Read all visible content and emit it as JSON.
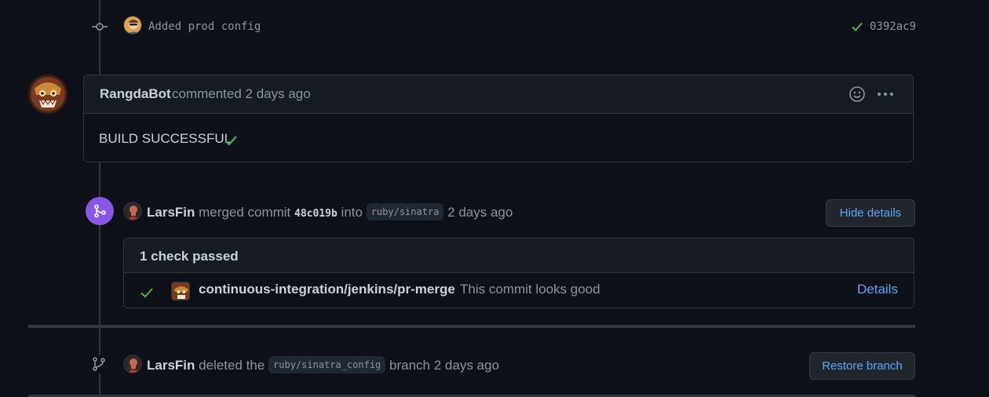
{
  "commit": {
    "message": "Added prod config",
    "sha": "0392ac9"
  },
  "comment": {
    "author": "RangdaBot",
    "meta": "commented 2 days ago",
    "body": "BUILD SUCCESSFUL"
  },
  "merge_event": {
    "actor": "LarsFin",
    "text_before_sha": "merged commit",
    "sha": "48c019b",
    "text_into": "into",
    "branch": "ruby/sinatra",
    "time": "2 days ago",
    "hide_details_label": "Hide details"
  },
  "checks": {
    "title": "1 check passed",
    "items": [
      {
        "name": "continuous-integration/jenkins/pr-merge",
        "description": "This commit looks good",
        "details_label": "Details"
      }
    ]
  },
  "delete_event": {
    "actor": "LarsFin",
    "text_before_branch": "deleted the",
    "branch": "ruby/sinatra_config",
    "text_after_branch": "branch",
    "time": "2 days ago",
    "restore_label": "Restore branch"
  },
  "colors": {
    "background": "#0d1117",
    "success": "#3fb950",
    "merged": "#8957e5",
    "link": "#58a6ff"
  },
  "icons": [
    "git-commit-icon",
    "check-icon",
    "smiley-icon",
    "kebab-horizontal-icon",
    "git-merge-icon",
    "git-branch-icon"
  ]
}
